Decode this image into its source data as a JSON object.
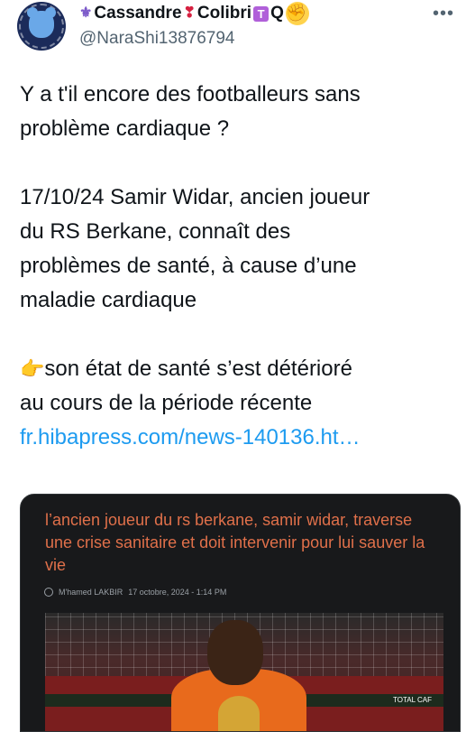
{
  "author": {
    "display_name_start": "Cassandre",
    "display_name_mid": "Colibri",
    "display_name_end": "Q",
    "badge_letter": "T",
    "handle": "@NaraShi13876794",
    "more_label": "•••"
  },
  "tweet": {
    "line1": "Y a t'il encore des footballeurs sans",
    "line2": "problème cardiaque ?",
    "para2": [
      "17/10/24 Samir Widar, ancien joueur",
      "du RS Berkane, connaît des",
      "problèmes de  santé, à cause d’une",
      "maladie cardiaque"
    ],
    "para3_line1": "son état de santé s’est détérioré",
    "para3_line2": "au cours de la période récente",
    "link": "fr.hibapress.com/news-140136.ht…"
  },
  "media": {
    "title": "l’ancien joueur du rs berkane, samir widar, traverse une crise sanitaire et doit intervenir pour lui sauver la vie",
    "author": "M'hamed LAKBIR",
    "date": "17 octobre, 2024 - 1:14 PM",
    "sign_text": "TOTAL CAF"
  }
}
